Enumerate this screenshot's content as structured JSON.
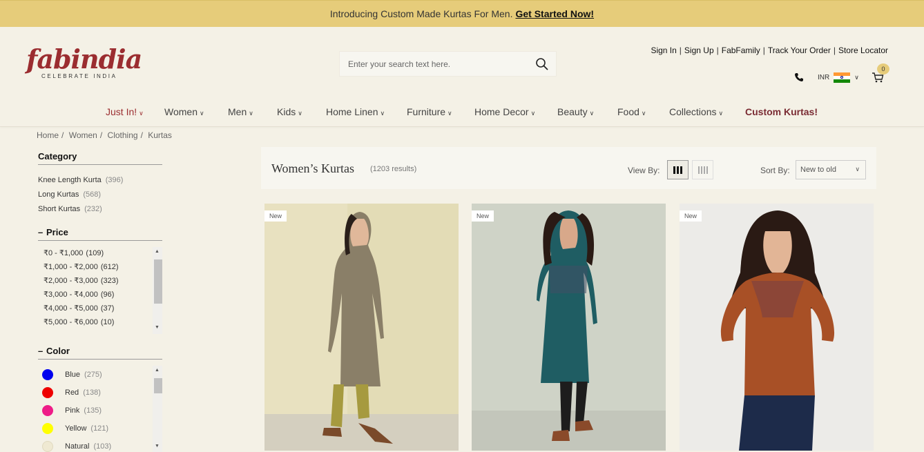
{
  "promo": {
    "text": "Introducing Custom Made Kurtas For Men.",
    "link": "Get Started Now!"
  },
  "brand": {
    "name": "fabindia",
    "tagline": "CELEBRATE INDIA",
    "color": "#9b2d30"
  },
  "search": {
    "placeholder": "Enter your search text here.",
    "icon": "search-icon"
  },
  "account_links": [
    "Sign In",
    "Sign Up",
    "FabFamily",
    "Track Your Order",
    "Store Locator"
  ],
  "utility": {
    "currency": "INR",
    "cart_count": "0"
  },
  "nav": [
    "Just In!",
    "Women",
    "Men",
    "Kids",
    "Home Linen",
    "Furniture",
    "Home Decor",
    "Beauty",
    "Food",
    "Collections",
    "Custom Kurtas!"
  ],
  "breadcrumb": [
    "Home",
    "Women",
    "Clothing",
    "Kurtas"
  ],
  "filters": {
    "category": {
      "title": "Category",
      "items": [
        {
          "label": "Knee Length Kurta",
          "count": "(396)"
        },
        {
          "label": "Long Kurtas",
          "count": "(568)"
        },
        {
          "label": "Short Kurtas",
          "count": "(232)"
        }
      ]
    },
    "price": {
      "title": "Price",
      "items": [
        {
          "label": "₹0  -  ₹1,000",
          "count": "(109)"
        },
        {
          "label": "₹1,000  -  ₹2,000",
          "count": "(612)"
        },
        {
          "label": "₹2,000  -  ₹3,000",
          "count": "(323)"
        },
        {
          "label": "₹3,000  -  ₹4,000",
          "count": "(96)"
        },
        {
          "label": "₹4,000  -  ₹5,000",
          "count": "(37)"
        },
        {
          "label": "₹5,000  -  ₹6,000",
          "count": "(10)"
        }
      ]
    },
    "color": {
      "title": "Color",
      "items": [
        {
          "label": "Blue",
          "count": "(275)",
          "hex": "#0000ee"
        },
        {
          "label": "Red",
          "count": "(138)",
          "hex": "#ee0000"
        },
        {
          "label": "Pink",
          "count": "(135)",
          "hex": "#ee1c88"
        },
        {
          "label": "Yellow",
          "count": "(121)",
          "hex": "#ffff00"
        },
        {
          "label": "Natural",
          "count": "(103)",
          "hex": "#efe9d2"
        }
      ]
    }
  },
  "results": {
    "title": "Women’s Kurtas",
    "count": "(1203 results)",
    "view_by": "View By:",
    "sort_by": "Sort By:",
    "sort_value": "New to old"
  },
  "products": [
    {
      "badge": "New",
      "bg": "#ddd7b3",
      "garment": "#8a7f68",
      "pants": "#a69a3f"
    },
    {
      "badge": "New",
      "bg": "#c9cdc2",
      "garment": "#1f5d63",
      "pants": "#1d1d1d"
    },
    {
      "badge": "New",
      "bg": "#ebebe9",
      "garment": "#a85026",
      "pants": "#1d2b4a"
    }
  ]
}
